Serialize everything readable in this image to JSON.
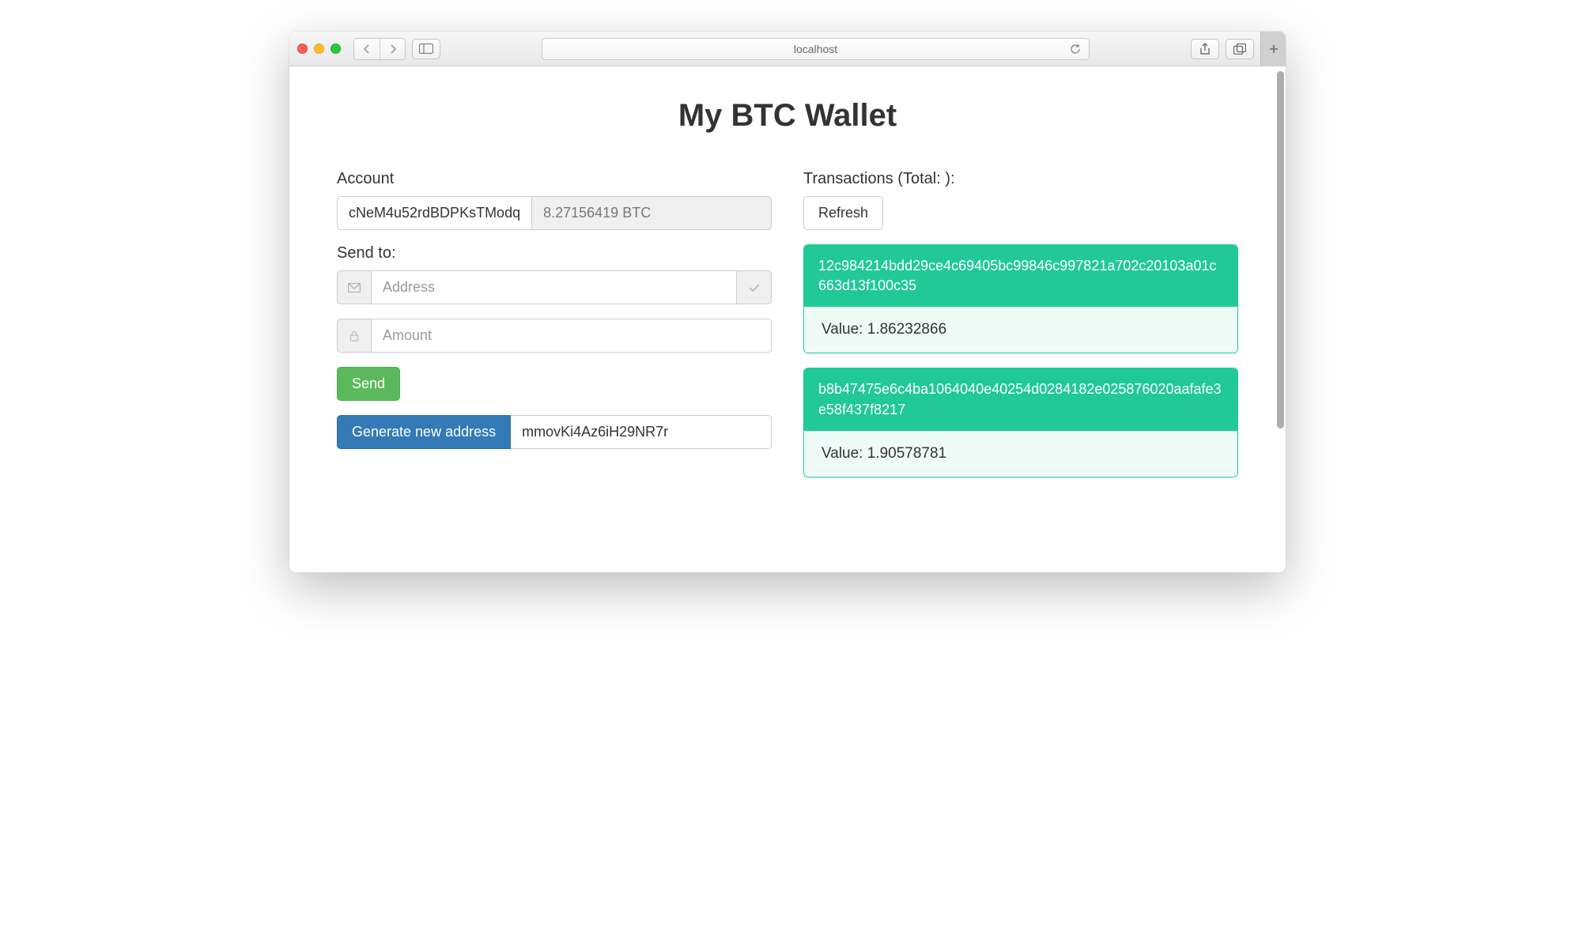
{
  "browser": {
    "url": "localhost"
  },
  "page": {
    "title": "My BTC Wallet"
  },
  "account": {
    "label": "Account",
    "private_key": "cNeM4u52rdBDPKsTModq",
    "balance_display": "8.27156419 BTC"
  },
  "send": {
    "label": "Send to:",
    "address_placeholder": "Address",
    "address_value": "",
    "amount_placeholder": "Amount",
    "amount_value": "",
    "send_button": "Send"
  },
  "generate": {
    "button": "Generate new address",
    "address": "mmovKi4Az6iH29NR7r"
  },
  "transactions": {
    "label_prefix": "Transactions (Total: ",
    "total": "",
    "label_suffix": "):",
    "refresh_button": "Refresh",
    "value_prefix": "Value: ",
    "items": [
      {
        "hash": "12c984214bdd29ce4c69405bc99846c997821a702c20103a01c663d13f100c35",
        "value": "1.86232866"
      },
      {
        "hash": "b8b47475e6c4ba1064040e40254d0284182e025876020aafafe3e58f437f8217",
        "value": "1.90578781"
      }
    ]
  }
}
